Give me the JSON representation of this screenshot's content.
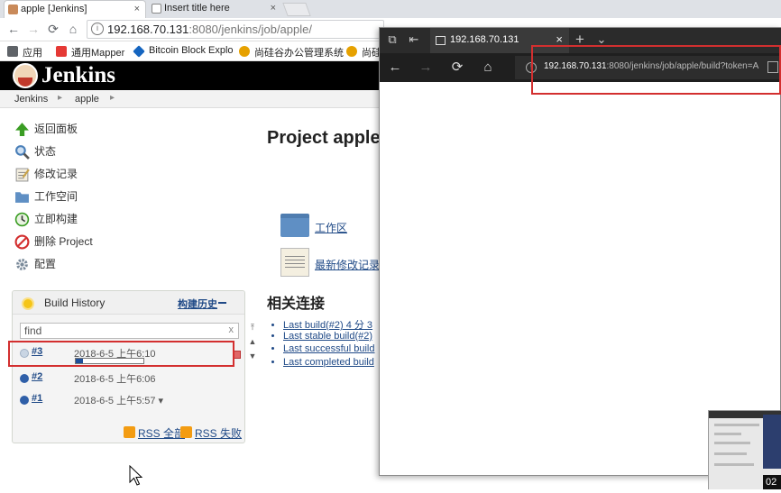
{
  "chrome": {
    "tabs": [
      {
        "title": "apple [Jenkins]",
        "close": "×"
      },
      {
        "title": "Insert title here",
        "close": "×"
      }
    ],
    "url_host": "192.168.70.131",
    "url_path": ":8080/jenkins/job/apple/",
    "bookmarks": [
      {
        "label": "应用",
        "color": "#5f6368"
      },
      {
        "label": "通用Mapper",
        "color": "#e53935"
      },
      {
        "label": "Bitcoin Block Explo",
        "color": "#1565c0"
      },
      {
        "label": "尚硅谷办公管理系统",
        "color": "#e6a100"
      },
      {
        "label": "尚硅",
        "color": "#e6a100"
      }
    ]
  },
  "jenkins": {
    "title": "Jenkins",
    "breadcrumb": [
      "Jenkins",
      "apple"
    ],
    "breadcrumb_sep": "▸",
    "side_tasks": [
      {
        "label": "返回面板",
        "icon": "up-arrow-icon",
        "color": "#3a9d23"
      },
      {
        "label": "状态",
        "icon": "magnifier-icon",
        "color": "#4a7fb8"
      },
      {
        "label": "修改记录",
        "icon": "notepad-icon",
        "color": "#c9a44a"
      },
      {
        "label": "工作空间",
        "icon": "folder-icon",
        "color": "#5f8fc4"
      },
      {
        "label": "立即构建",
        "icon": "build-clock-icon",
        "color": "#3a9d23"
      },
      {
        "label": "删除 Project",
        "icon": "no-entry-icon",
        "color": "#d32f2f"
      },
      {
        "label": "配置",
        "icon": "gear-icon",
        "color": "#7a8a9a"
      }
    ],
    "build_history": {
      "title": "Build History",
      "trend": "构建历史",
      "find_value": "find",
      "find_clear": "x",
      "builds": [
        {
          "num": "#3",
          "time": "2018-6-5 上午6:10",
          "ball_color": "#c9d5e3",
          "progress": 0.1,
          "in_progress": true
        },
        {
          "num": "#2",
          "time": "2018-6-5 上午6:06",
          "ball_color": "#2f5fa8",
          "in_progress": false
        },
        {
          "num": "#1",
          "time": "2018-6-5 上午5:57 ▾",
          "ball_color": "#2f5fa8",
          "in_progress": false
        }
      ],
      "rss_all": "RSS 全部",
      "rss_fail": "RSS 失败"
    },
    "main": {
      "project_title": "Project apple",
      "workspace_link": "工作区",
      "changes_link": "最新修改记录",
      "related_title": "相关连接",
      "related_links": [
        "Last build(#2) 4 分 3",
        "Last stable build(#2)",
        "Last successful build",
        "Last completed build"
      ]
    }
  },
  "edge": {
    "tab_title": "192.168.70.131",
    "tab_close": "×",
    "new_tab": "+",
    "tab_menu": "⌄",
    "url_host": "192.168.70.131",
    "url_path": ":8080/jenkins/job/apple/build?token=A"
  },
  "video": {
    "timestamp": "02"
  }
}
